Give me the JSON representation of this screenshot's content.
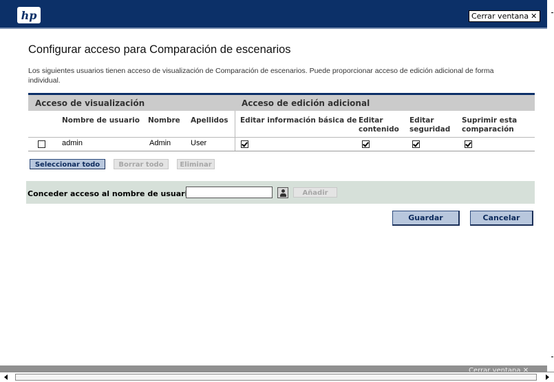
{
  "header": {
    "logo_text": "hp",
    "close_window_label": "Cerrar ventana",
    "close_icon": "close-x-icon",
    "brand_color": "#0c3068"
  },
  "page": {
    "title": "Configurar acceso para Comparación de escenarios",
    "description": "Los siguientes usuarios tienen acceso de visualización de Comparación de escenarios. Puede proporcionar acceso de edición adicional de forma individual."
  },
  "table": {
    "group_view": "Acceso de visualización",
    "group_edit": "Acceso de edición adicional",
    "columns": {
      "username": "Nombre de usuario",
      "first_name": "Nombre",
      "last_name": "Apellidos",
      "edit_basic": "Editar información básica de",
      "edit_content": "Editar contenido",
      "edit_security": "Editar seguridad",
      "delete": "Suprimir esta comparación"
    },
    "rows": [
      {
        "selected": false,
        "username": "admin",
        "first_name": "Admin",
        "last_name": "User",
        "edit_basic": true,
        "edit_content": true,
        "edit_security": true,
        "delete": true
      }
    ]
  },
  "table_actions": {
    "select_all": "Seleccionar todo",
    "clear_all": "Borrar todo",
    "remove": "Eliminar"
  },
  "grant": {
    "label": "Conceder acceso al nombre de usuario:",
    "input_value": "",
    "lookup_icon": "user-lookup-icon",
    "add_label": "Añadir"
  },
  "actions": {
    "save": "Guardar",
    "cancel": "Cancelar"
  },
  "footer": {
    "close_window_label": "Cerrar ventana"
  }
}
